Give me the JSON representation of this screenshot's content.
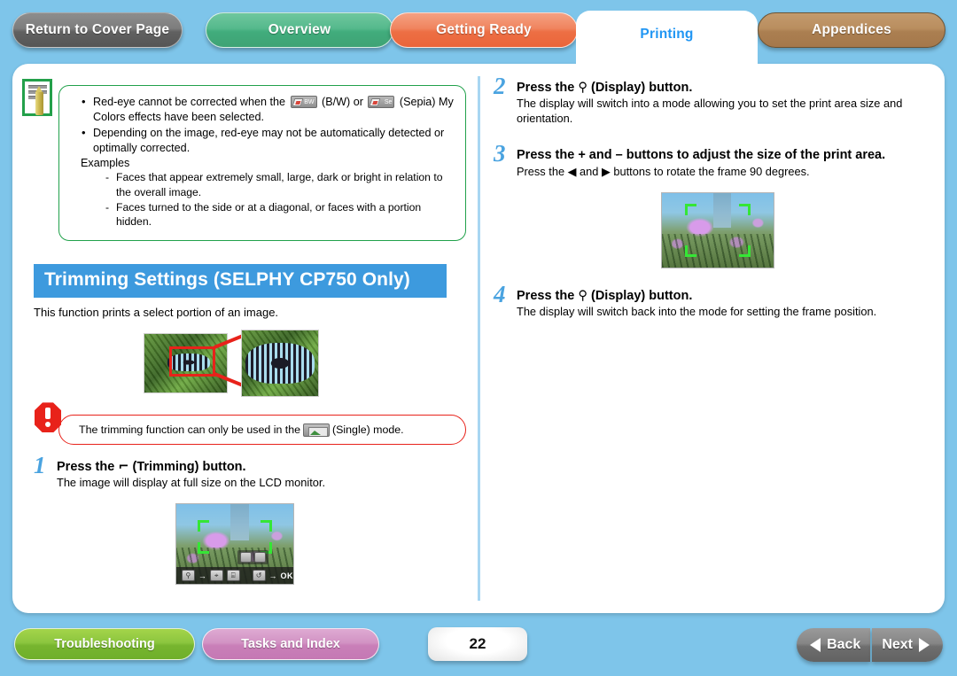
{
  "tabs": [
    {
      "id": "return-to-cover-page",
      "label": "Return to Cover Page",
      "color": "#7d7d7d",
      "active": false
    },
    {
      "id": "overview",
      "label": "Overview",
      "color": "#55b98c",
      "active": false
    },
    {
      "id": "getting-ready",
      "label": "Getting Ready",
      "color": "#f0845e",
      "active": false
    },
    {
      "id": "printing",
      "label": "Printing",
      "color": "#2196f3",
      "active": true
    },
    {
      "id": "appendices",
      "label": "Appendices",
      "color": "#b98e5f",
      "active": false
    }
  ],
  "note": {
    "icon": "note-pencil-icon",
    "bullets": [
      {
        "pre": "Red-eye cannot be corrected when the",
        "chip1": "BW",
        "mid1": "(B/W) or",
        "chip2": "Se",
        "post": "(Sepia) My Colors effects have been selected."
      },
      {
        "pre": "Depending on the image, red-eye may not be automatically detected or optimally corrected."
      }
    ],
    "examples_label": "Examples",
    "examples": [
      "Faces that appear extremely small, large, dark or bright in relation to the overall image.",
      "Faces turned to the side or at a diagonal, or faces with a portion hidden."
    ]
  },
  "section": {
    "heading": "Trimming Settings (SELPHY CP750 Only)",
    "intro": "This function prints a select portion of an image."
  },
  "warning": {
    "icon": "warning-octagon-icon",
    "pre": "The trimming function can only be used in the",
    "chip": "single-photo-icon",
    "post": "(Single) mode."
  },
  "steps": [
    {
      "num": "1",
      "title_pre": "Press the",
      "title_glyph": "⌐",
      "title_post": "(Trimming) button.",
      "body": "The image will display at full size on the LCD monitor.",
      "column": "left"
    },
    {
      "num": "2",
      "title_pre": "Press the",
      "title_glyph": "⚲",
      "title_post": "(Display) button.",
      "body": "The display will switch into a mode allowing you to set the print area size and orientation.",
      "column": "right"
    },
    {
      "num": "3",
      "title_pre": "Press the + and – buttons to adjust the size of the print area.",
      "title_glyph": "",
      "title_post": "",
      "body_pre": "Press the",
      "body_glyph_left": "◀",
      "body_mid": "and",
      "body_glyph_right": "▶",
      "body_post": "buttons to rotate the frame 90 degrees.",
      "column": "right"
    },
    {
      "num": "4",
      "title_pre": "Press the",
      "title_glyph": "⚲",
      "title_post": "(Display) button.",
      "body": "The display will switch back into the mode for setting the frame position.",
      "column": "right"
    }
  ],
  "lcd_step1": {
    "name": "lcd-trimming-frame-preview",
    "bar_icons": [
      "⚲",
      "→",
      "⌖",
      "⌸",
      "↺",
      "→",
      "OK"
    ]
  },
  "lcd_step3": {
    "name": "lcd-print-area-size-preview"
  },
  "illustration": {
    "name": "trimming-example-butterfly",
    "source_photo": "butterfly-full-photo",
    "result_photo": "butterfly-trimmed-photo",
    "selection": "red-selection-rectangle"
  },
  "bottom": {
    "troubleshooting": "Troubleshooting",
    "tasks_and_index": "Tasks and Index",
    "page_number": "22",
    "back": "Back",
    "next": "Next"
  }
}
